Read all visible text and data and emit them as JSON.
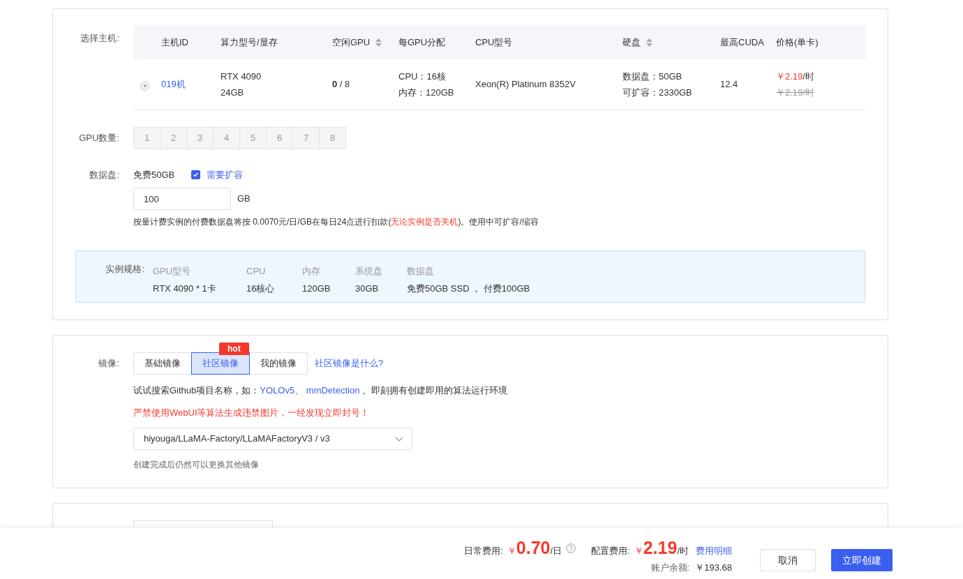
{
  "host_section": {
    "label": "选择主机:",
    "columns": [
      {
        "label": "主机ID",
        "sortable": false
      },
      {
        "label": "算力型号/显存",
        "sortable": false
      },
      {
        "label": "空闲GPU",
        "sortable": true
      },
      {
        "label": "每GPU分配",
        "sortable": false
      },
      {
        "label": "CPU型号",
        "sortable": false
      },
      {
        "label": "硬盘",
        "sortable": true
      },
      {
        "label": "最高CUDA",
        "sortable": false
      },
      {
        "label": "价格(单卡)",
        "sortable": false
      }
    ],
    "rows": [
      {
        "selected": true,
        "disabled": true,
        "id": "019机",
        "gpu_model": "RTX 4090",
        "gpu_memory": "24GB",
        "free_gpu": "0",
        "total_gpu": "/ 8",
        "cpu": "CPU：16核",
        "memory": "内存：120GB",
        "cpu_model": "Xeon(R) Platinum 8352V",
        "data_disk": "数据盘：50GB",
        "expandable": "可扩容：2330GB",
        "cuda": "12.4",
        "price": "￥2.19",
        "price_unit": "/时",
        "original_price": "￥2.19/时"
      }
    ]
  },
  "gpu_count": {
    "label": "GPU数量:",
    "options": [
      {
        "label": "1",
        "disabled": true
      },
      {
        "label": "2",
        "disabled": true
      },
      {
        "label": "3",
        "disabled": true
      },
      {
        "label": "4",
        "disabled": true
      },
      {
        "label": "5",
        "disabled": true
      },
      {
        "label": "6",
        "disabled": true
      },
      {
        "label": "7",
        "disabled": true
      },
      {
        "label": "8",
        "disabled": true
      }
    ]
  },
  "data_disk": {
    "label": "数据盘:",
    "free": "免费50GB",
    "expand": {
      "label": "需要扩容",
      "checked": true
    },
    "size": "100",
    "unit": "GB",
    "note_parts": [
      {
        "kind": "text",
        "text": "按量计费实例的付费数据盘将按 0.0070元/日/GB在每日24点进行扣款("
      },
      {
        "kind": "warning",
        "text": "无论实例是否关机"
      },
      {
        "kind": "text",
        "text": ")。使用中可扩容/缩容"
      }
    ]
  },
  "spec": {
    "label": "实例规格:",
    "items": [
      {
        "name": "GPU型号",
        "value": "RTX 4090 * 1卡"
      },
      {
        "name": "CPU",
        "value": "16核心"
      },
      {
        "name": "内存",
        "value": "120GB"
      },
      {
        "name": "系统盘",
        "value": "30GB"
      },
      {
        "name": "数据盘",
        "value": "免费50GB SSD ， 付费100GB"
      }
    ]
  },
  "image": {
    "label": "镜像:",
    "tabs": [
      {
        "label": "基础镜像",
        "selected": false
      },
      {
        "label": "社区镜像",
        "selected": true,
        "badge": "hot"
      },
      {
        "label": "我的镜像",
        "selected": false
      }
    ],
    "help_link": "社区镜像是什么?",
    "hint_parts": [
      {
        "kind": "text",
        "text": "试试搜索Github项目名称，如："
      },
      {
        "kind": "link",
        "text": "YOLOv5"
      },
      {
        "kind": "text",
        "text": "、 "
      },
      {
        "kind": "link",
        "text": "mmDetection"
      },
      {
        "kind": "text",
        "text": " 。即刻拥有创建即用的算法运行环境"
      }
    ],
    "warning": "严禁使用WebUI等算法生成违禁图片，一经发现立即封号！",
    "select_value": "hiyouga/LLaMA-Factory/LLaMAFactoryV3 / v3",
    "note": "创建完成后仍然可以更换其他镜像"
  },
  "footer": {
    "daily_label": "日常费用:",
    "daily_currency": "￥",
    "daily_amount": "0.70",
    "daily_unit": "/日",
    "config_label": "配置费用:",
    "config_currency": "￥",
    "config_amount": "2.19",
    "config_unit": "/时",
    "details_link": "费用明细",
    "balance_label": "账户余额:",
    "balance": "￥193.68",
    "buttons": [
      {
        "label": "取消",
        "kind": "secondary"
      },
      {
        "label": "立即创建",
        "kind": "primary"
      }
    ]
  }
}
